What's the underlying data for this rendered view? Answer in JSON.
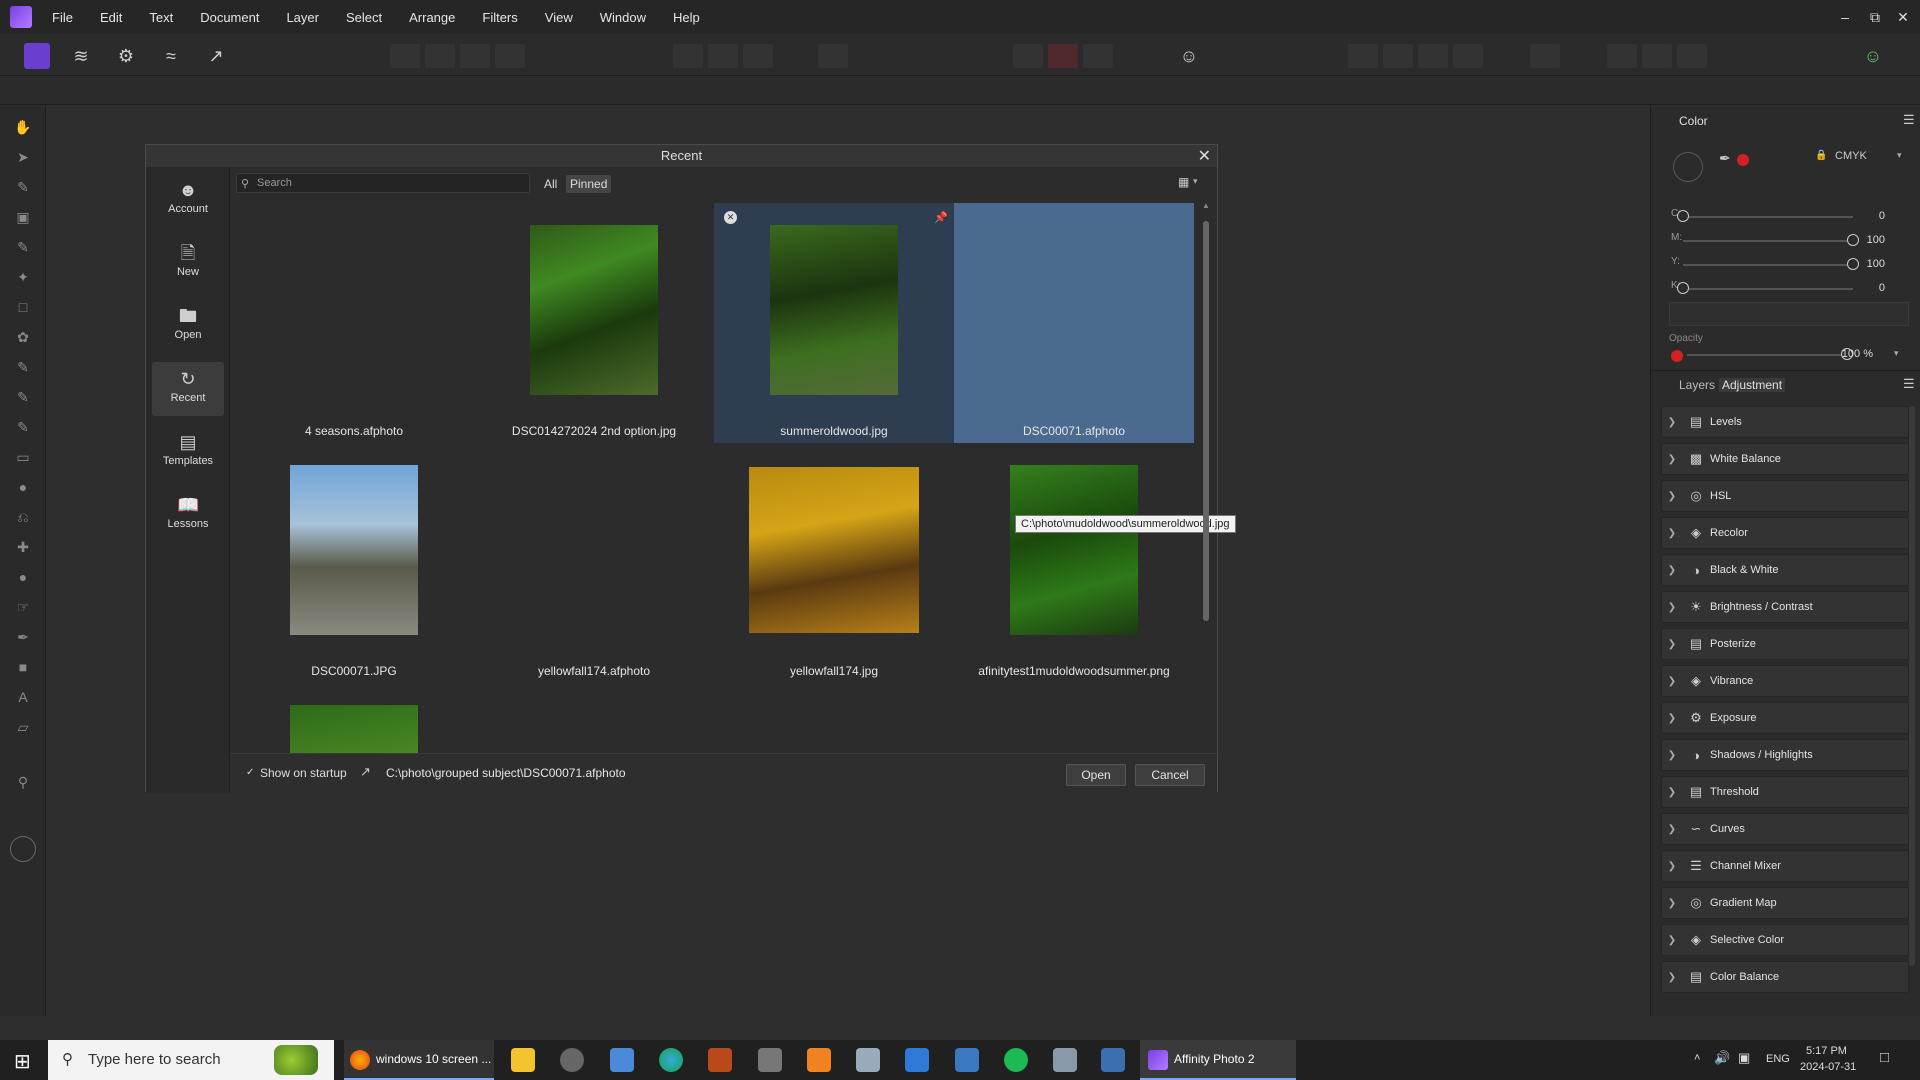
{
  "menu": [
    "File",
    "Edit",
    "Text",
    "Document",
    "Layer",
    "Select",
    "Arrange",
    "Filters",
    "View",
    "Window",
    "Help"
  ],
  "dialog": {
    "title": "Recent",
    "sidebar": [
      "Account",
      "New",
      "Open",
      "Recent",
      "Templates",
      "Lessons"
    ],
    "search_placeholder": "Search",
    "filters": [
      "All",
      "Pinned"
    ],
    "files": [
      {
        "name": "4 seasons.afphoto"
      },
      {
        "name": "DSC014272024 2nd option.jpg"
      },
      {
        "name": "summeroldwood.jpg"
      },
      {
        "name": "DSC00071.afphoto"
      },
      {
        "name": "DSC00071.JPG"
      },
      {
        "name": "yellowfall174.afphoto"
      },
      {
        "name": "yellowfall174.jpg"
      },
      {
        "name": "afinitytest1mudoldwoodsummer.png"
      }
    ],
    "tooltip": "C:\\photo\\mudoldwood\\summeroldwood.jpg",
    "show_on_startup": "Show on startup",
    "path": "C:\\photo\\grouped subject\\DSC00071.afphoto",
    "open_label": "Open",
    "cancel_label": "Cancel"
  },
  "color_panel": {
    "tab": "Color",
    "model": "CMYK",
    "channels": [
      {
        "label": "C:",
        "value": "0",
        "frac": 0.0
      },
      {
        "label": "M:",
        "value": "100",
        "frac": 1.0
      },
      {
        "label": "Y:",
        "value": "100",
        "frac": 1.0
      },
      {
        "label": "K:",
        "value": "0",
        "frac": 0.0
      }
    ],
    "opacity_label": "Opacity",
    "opacity_value": "100 %",
    "opacity_frac": 1.0,
    "accent": "#d42020"
  },
  "adjust_panel": {
    "tabs": [
      "Layers",
      "Adjustment"
    ],
    "items": [
      "Levels",
      "White Balance",
      "HSL",
      "Recolor",
      "Black & White",
      "Brightness / Contrast",
      "Posterize",
      "Vibrance",
      "Exposure",
      "Shadows / Highlights",
      "Threshold",
      "Curves",
      "Channel Mixer",
      "Gradient Map",
      "Selective Color",
      "Color Balance"
    ]
  },
  "taskbar": {
    "search_placeholder": "Type here to search",
    "firefox_label": "windows 10 screen ...",
    "affinity_label": "Affinity Photo 2",
    "time": "5:17 PM",
    "date": "2024-07-31",
    "lang": "ENG"
  }
}
